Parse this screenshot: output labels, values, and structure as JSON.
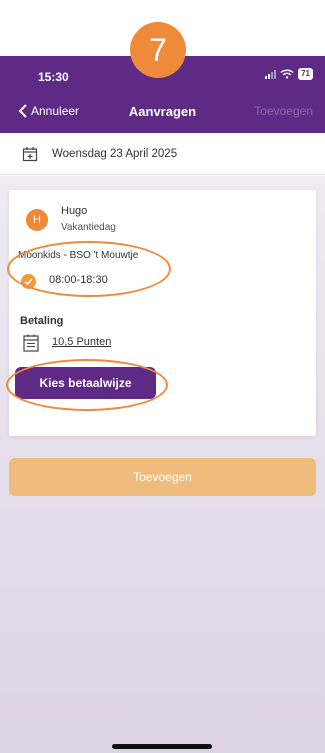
{
  "step": {
    "number": "7",
    "color": "#ee8a3a"
  },
  "status_bar": {
    "time": "15:30",
    "battery": "71"
  },
  "nav": {
    "back_label": "Annuleer",
    "title": "Aanvragen",
    "add_label": "Toevoegen",
    "color": "#5e2a86"
  },
  "date": {
    "label": "Woensdag 23 April 2025",
    "icon": "calendar-plus-icon"
  },
  "booking": {
    "avatar_initial": "H",
    "child_name": "Hugo",
    "day_type": "Vakantiedag",
    "location": "Moonkids - BSO 't Mouwtje",
    "time_range": "08:00-18:30",
    "payment_label": "Betaling",
    "points": "10,5 Punten",
    "choose_payment_button": "Kies betaalwijze"
  },
  "footer": {
    "add_button": "Toevoegen",
    "add_button_color": "#f0bc7c"
  }
}
